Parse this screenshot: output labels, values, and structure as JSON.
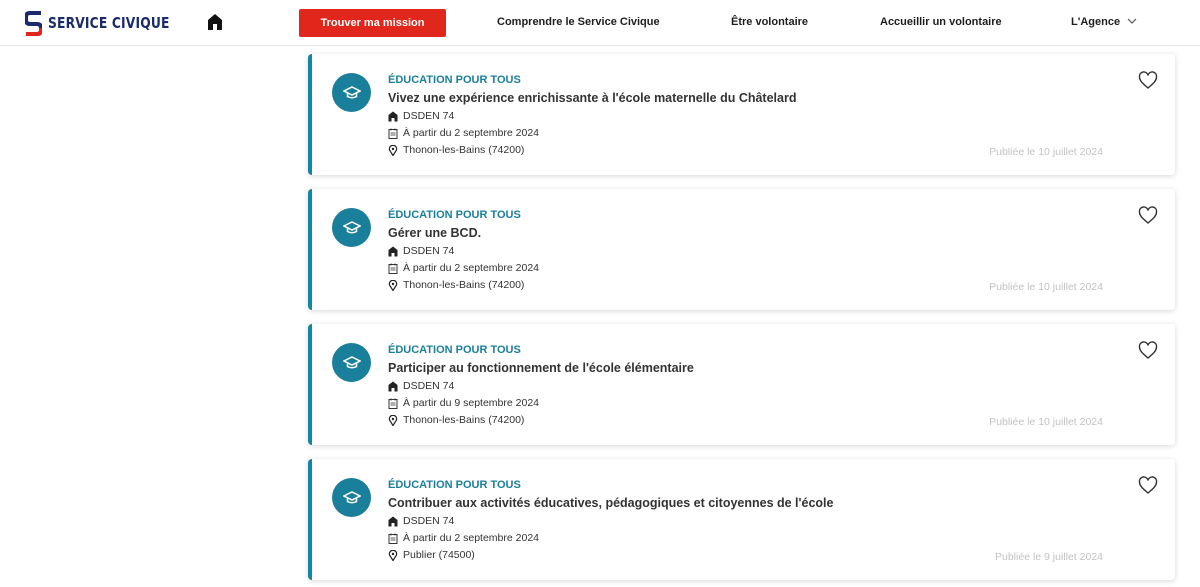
{
  "header": {
    "logo_text": "SERVICE CIVIQUE",
    "nav": {
      "primary": "Trouver ma mission",
      "comprendre": "Comprendre le Service Civique",
      "volontaire": "Être volontaire",
      "accueillir": "Accueillir un volontaire",
      "agence": "L'Agence"
    },
    "colors": {
      "primary_button": "#e1261c",
      "logo": "#1b2a6b"
    }
  },
  "missions": [
    {
      "category": "ÉDUCATION POUR TOUS",
      "title": "Vivez une expérience enrichissante à l'école maternelle du Châtelard",
      "organization": "DSDEN 74",
      "start": "À partir du 2 septembre 2024",
      "location": "Thonon-les-Bains (74200)",
      "published": "Publiée le 10 juillet 2024"
    },
    {
      "category": "ÉDUCATION POUR TOUS",
      "title": "Gérer une BCD.",
      "organization": "DSDEN 74",
      "start": "À partir du 2 septembre 2024",
      "location": "Thonon-les-Bains (74200)",
      "published": "Publiée le 10 juillet 2024"
    },
    {
      "category": "ÉDUCATION POUR TOUS",
      "title": "Participer au fonctionnement de l'école élémentaire",
      "organization": "DSDEN 74",
      "start": "À partir du 9 septembre 2024",
      "location": "Thonon-les-Bains (74200)",
      "published": "Publiée le 10 juillet 2024"
    },
    {
      "category": "ÉDUCATION POUR TOUS",
      "title": "Contribuer aux activités éducatives, pédagogiques et citoyennes de l'école",
      "organization": "DSDEN 74",
      "start": "À partir du 2 septembre 2024",
      "location": "Publier (74500)",
      "published": "Publiée le 9 juillet 2024"
    }
  ],
  "icons": {
    "category": "graduation-cap-icon",
    "organization": "building-icon",
    "start": "calendar-icon",
    "location": "map-pin-icon",
    "favorite": "heart-icon"
  },
  "colors": {
    "accent": "#1a7f9a",
    "card_border": "#1287a0",
    "date": "#c2c2c2"
  }
}
